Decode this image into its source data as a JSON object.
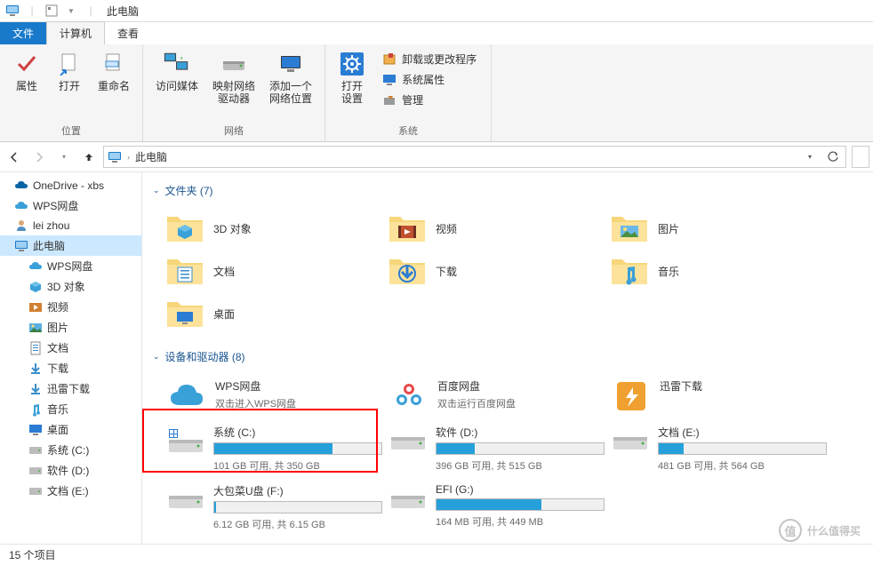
{
  "window": {
    "title": "此电脑"
  },
  "tabs": {
    "file": "文件",
    "computer": "计算机",
    "view": "查看"
  },
  "ribbon": {
    "location": {
      "label": "位置",
      "properties": "属性",
      "open": "打开",
      "rename": "重命名"
    },
    "network": {
      "label": "网络",
      "media": "访问媒体",
      "mapdrive": "映射网络\n驱动器",
      "addplace": "添加一个\n网络位置"
    },
    "system": {
      "label": "系统",
      "opensettings": "打开\n设置",
      "uninstall": "卸载或更改程序",
      "sysprops": "系统属性",
      "manage": "管理"
    }
  },
  "addr": {
    "path": "此电脑"
  },
  "tree": {
    "onedrive": "OneDrive - xbs",
    "wps": "WPS网盘",
    "user": "lei zhou",
    "thispc": "此电脑",
    "sub": {
      "wps": "WPS网盘",
      "3d": "3D 对象",
      "videos": "视频",
      "pictures": "图片",
      "docs": "文档",
      "downloads": "下载",
      "xunlei": "迅雷下载",
      "music": "音乐",
      "desktop": "桌面",
      "c": "系统 (C:)",
      "d": "软件 (D:)",
      "e": "文档 (E:)"
    }
  },
  "sections": {
    "folders": {
      "title": "文件夹 (7)",
      "items": {
        "3d": "3D 对象",
        "videos": "视频",
        "pictures": "图片",
        "docs": "文档",
        "downloads": "下载",
        "music": "音乐",
        "desktop": "桌面"
      }
    },
    "drives": {
      "title": "设备和驱动器 (8)",
      "items": {
        "wps": {
          "name": "WPS网盘",
          "sub": "双击进入WPS网盘"
        },
        "baidu": {
          "name": "百度网盘",
          "sub": "双击运行百度网盘"
        },
        "xunlei": {
          "name": "迅雷下载",
          "sub": ""
        },
        "c": {
          "name": "系统 (C:)",
          "sub": "101 GB 可用, 共 350 GB",
          "pct": 71
        },
        "d": {
          "name": "软件 (D:)",
          "sub": "396 GB 可用, 共 515 GB",
          "pct": 23
        },
        "e": {
          "name": "文档 (E:)",
          "sub": "481 GB 可用, 共 564 GB",
          "pct": 15
        },
        "f": {
          "name": "大包菜U盘 (F:)",
          "sub": "6.12 GB 可用, 共 6.15 GB",
          "pct": 1
        },
        "g": {
          "name": "EFI (G:)",
          "sub": "164 MB 可用, 共 449 MB",
          "pct": 63
        }
      }
    }
  },
  "status": {
    "text": "15 个项目"
  },
  "watermark": {
    "text": "什么值得买"
  },
  "colors": {
    "accent": "#26a0da",
    "filetab": "#1979ca"
  }
}
